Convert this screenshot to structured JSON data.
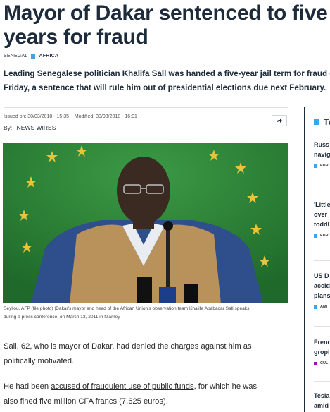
{
  "article": {
    "headline": "Mayor of Dakar sentenced to five years for fraud",
    "headline_line1": "Mayor of Dakar sentenced to five",
    "headline_line2": "years for fraud",
    "tags": {
      "country": "SENEGAL",
      "region": "AFRICA"
    },
    "lead_line1": "Leading Senegalese politician Khalifa Sall was handed a five-year jail term for fraud o",
    "lead_line2": "Friday, a sentence that will rule him out of presidential elections due next February.",
    "issued": "Issued on: 30/03/2018 - 15:35",
    "modified": "Modified: 30/03/2018 - 16:01",
    "by_label": "By:",
    "author": "NEWS WIRES",
    "share_icon": "share-arrow-icon",
    "caption_line1": "Seyllou, AFP (file photo) |Dakar's mayor and head of the African Union's observation team Khalifa Ababacar Sall speaks",
    "caption_line2": "during a press conference, on March 13, 2011 in Niamey",
    "p1_line1": "Sall, 62, who is mayor of Dakar, had denied the charges against him as",
    "p1_line2": "politically motivated.",
    "p2_before": "He had been ",
    "p2_link": "accused of fraudulent use of public funds",
    "p2_after": ", for which he was",
    "p2_line2": "also fined five million CFA francs (7,625 euros)."
  },
  "sidebar": {
    "title": "To",
    "items": [
      {
        "line1": "Russ",
        "line2": "navig",
        "category": "EUR"
      },
      {
        "line1": "'Little",
        "line2": "over",
        "line3": "toddl",
        "category": "EUR"
      },
      {
        "line1": "US D",
        "line2": "accid",
        "line3": "plans",
        "category": "AMI"
      },
      {
        "line1": "Frenc",
        "line2": "gropi",
        "category": "CUL"
      },
      {
        "line1": "Tesla",
        "line2": "amid"
      }
    ]
  },
  "colors": {
    "accent": "#3aa6e6",
    "navy": "#1d2b3a",
    "culture": "#8a1b9c"
  }
}
